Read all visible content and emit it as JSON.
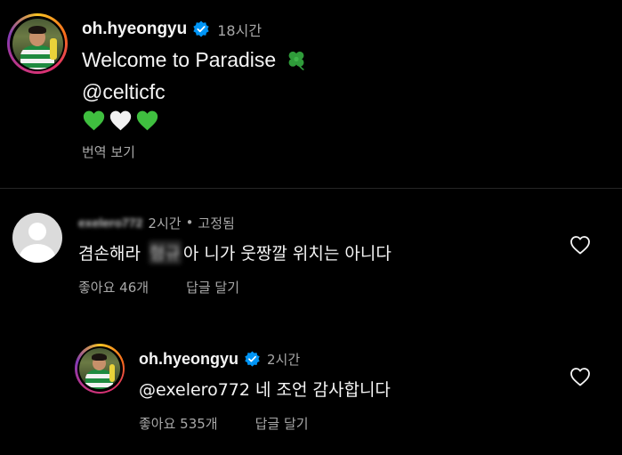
{
  "caption": {
    "username": "oh.hyeongyu",
    "timestamp": "18시간",
    "lines": [
      "Welcome to Paradise",
      "@celticfc"
    ],
    "emoji_icons": [
      "four-leaf-clover-icon",
      "green-heart-icon",
      "white-heart-icon",
      "green-heart-icon"
    ],
    "translate_label": "번역 보기"
  },
  "comments": [
    {
      "username": "exelero772",
      "timestamp": "2시간",
      "pinned_label": "고정됨",
      "text_before": "겸손해라",
      "blurred_name": "형규",
      "text_after": "아 니가 웃짱깔 위치는 아니다",
      "likes_label": "좋아요 46개",
      "reply_label": "답글 달기"
    },
    {
      "username": "oh.hyeongyu",
      "timestamp": "2시간",
      "text": "@exelero772 네 조언 감사합니다",
      "likes_label": "좋아요 535개",
      "reply_label": "답글 달기"
    }
  ],
  "colors": {
    "background": "#000000",
    "primary_text": "#f5f5f5",
    "secondary_text": "#a8a8a8",
    "verified_blue": "#0095f6",
    "divider": "#262626"
  }
}
